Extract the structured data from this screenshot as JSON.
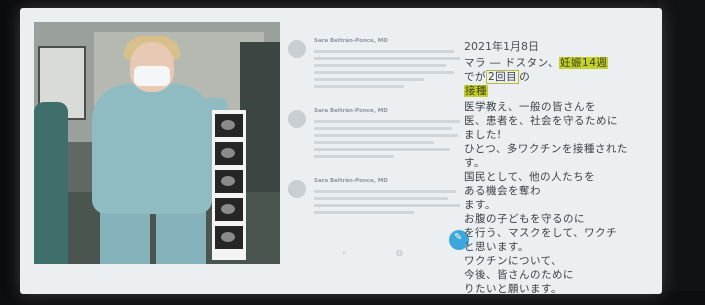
{
  "tweets": [
    {
      "author": "Sara Beltrán-Ponce, MD"
    },
    {
      "author": "Sara Beltrán-Ponce, MD"
    },
    {
      "author": "Sara Beltrán-Ponce, MD"
    }
  ],
  "japanese_post": {
    "date": "2021年1月8日",
    "lines": [
      {
        "pre": "マラ ― ドスタン、",
        "highlight": "妊娠14週"
      },
      {
        "pre": "でが",
        "box": "2回目",
        "post": "の"
      },
      {
        "highlight": "接種"
      },
      {
        "pre": "医学教え、一般の皆さんを"
      },
      {
        "pre": "医、患者を、社会を守るために"
      },
      {
        "pre": "ました!"
      },
      {
        "pre": "ひとつ、多ワクチンを接種された"
      },
      {
        "pre": "す。"
      },
      {
        "pre": "国民として、他の人たちを"
      },
      {
        "pre": "ある機会を奪わ"
      },
      {
        "pre": "ます。"
      },
      {
        "pre": "お腹の子どもを守るのに"
      },
      {
        "pre": "を行う、マスクをして、ワクチ"
      },
      {
        "pre": "と思います。"
      },
      {
        "pre": "ワクチンについて、"
      },
      {
        "pre": "今後、皆さんのために"
      },
      {
        "pre": "りたいと願います。"
      }
    ]
  }
}
